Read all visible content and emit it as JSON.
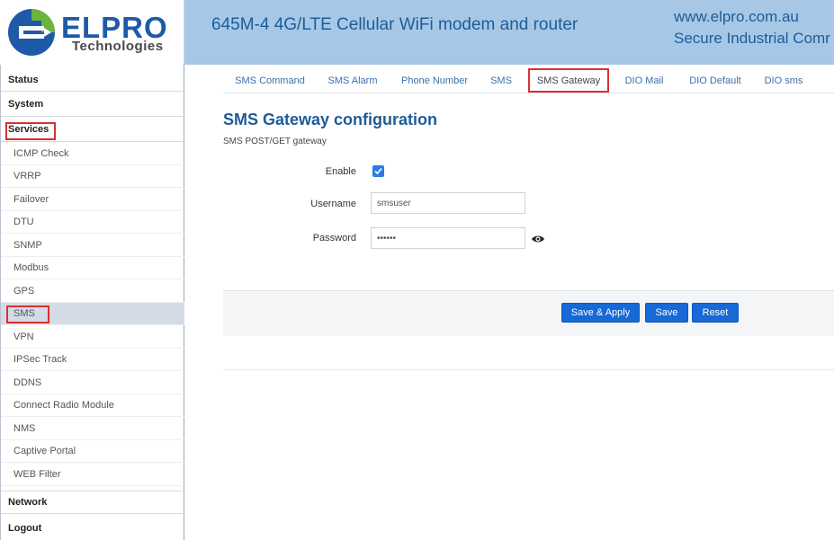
{
  "header": {
    "logo_name": "ELPRO",
    "logo_sub": "Technologies",
    "title": "645M-4 4G/LTE Cellular WiFi modem and router",
    "website": "www.elpro.com.au",
    "tagline": "Secure Industrial Comr",
    "colors": {
      "bar": "#a6c8e6",
      "text": "#1d5c98",
      "logo_blue": "#1e5aa8",
      "logo_green": "#6cb33f"
    }
  },
  "sidebar": {
    "status": "Status",
    "system": "System",
    "services": "Services",
    "services_items": [
      "ICMP Check",
      "VRRP",
      "Failover",
      "DTU",
      "SNMP",
      "Modbus",
      "GPS",
      "SMS",
      "VPN",
      "IPSec Track",
      "DDNS",
      "Connect Radio Module",
      "NMS",
      "Captive Portal",
      "WEB Filter"
    ],
    "active_item": "SMS",
    "network": "Network",
    "logout": "Logout"
  },
  "tabs": {
    "items": [
      "SMS Command",
      "SMS Alarm",
      "Phone Number",
      "SMS",
      "SMS Gateway",
      "DIO Mail",
      "DIO Default",
      "DIO sms"
    ],
    "active": "SMS Gateway"
  },
  "page": {
    "title": "SMS Gateway configuration",
    "description": "SMS POST/GET gateway"
  },
  "form": {
    "enable_label": "Enable",
    "enable_checked": true,
    "username_label": "Username",
    "username_value": "smsuser",
    "password_label": "Password",
    "password_value": "••••••",
    "password_toggle_icon": "eye-icon"
  },
  "actions": {
    "save_apply": "Save & Apply",
    "save": "Save",
    "reset": "Reset",
    "button_color": "#1669d6"
  }
}
